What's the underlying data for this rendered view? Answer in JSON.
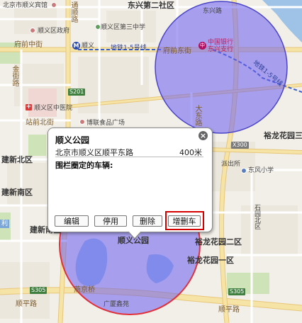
{
  "map": {
    "labels": {
      "beijing_shunyi_hotel": "北京市顺义宾馆",
      "shunyi_gov": "顺义区政府",
      "tonghui_road": "通顺路",
      "shunyi_no3_middle_school": "顺义区第三中学",
      "dongxing_community2": "东兴第二社区",
      "dongxing_road": "东兴路",
      "fuqian_street": "府前中街",
      "shunyi_metro": "顺义",
      "metro_line15": "地铁1-5号线",
      "fuqian_east_street": "府前东街",
      "bank_of_china": "中国银行\n东兴支行",
      "metro_line15_b": "地铁1-5号线",
      "jinjie_road": "金街路",
      "s201": "S201",
      "shunyi_hospital": "顺义区中医院",
      "zhanqian_road": "站前北街",
      "boyuan_plaza": "博联食品广场",
      "dadong_road": "大东路",
      "yulong_garden3": "裕龙花园三",
      "police": "派出所",
      "jianxin_north": "建新北区",
      "x300": "X300",
      "dongfeng_school": "东风小学",
      "shunyi_park_map": "顺义公园",
      "yulong_garden2": "裕龙花园二区",
      "shiyuan_north": "石园北区",
      "jianxin_south": "建新南区",
      "yulong_garden1": "裕龙花园一区",
      "s305": "S305",
      "yanjing_bridge": "燕京桥",
      "guangxia_plaza": "广厦鑫苑",
      "shunping_road": "顺平路",
      "li": "利",
      "metro_dot": "M",
      "bank_dot": "中",
      "hosp_dot": "+"
    }
  },
  "popup": {
    "title": "顺义公园",
    "address": "北京市顺义区顺平东路",
    "distance": "400米",
    "vehicles_label": "围栏圈定的车辆:",
    "buttons": {
      "edit": "编辑",
      "disable": "停用",
      "delete": "删除",
      "add_remove_vehicle": "增删车"
    },
    "close_icon": "close-icon"
  },
  "fences": [
    {
      "name": "bank-fence",
      "color": "#6a5cf0",
      "border": "#4a44c8"
    },
    {
      "name": "park-fence",
      "color": "#6a5cf0",
      "border": "#e0303a"
    }
  ]
}
